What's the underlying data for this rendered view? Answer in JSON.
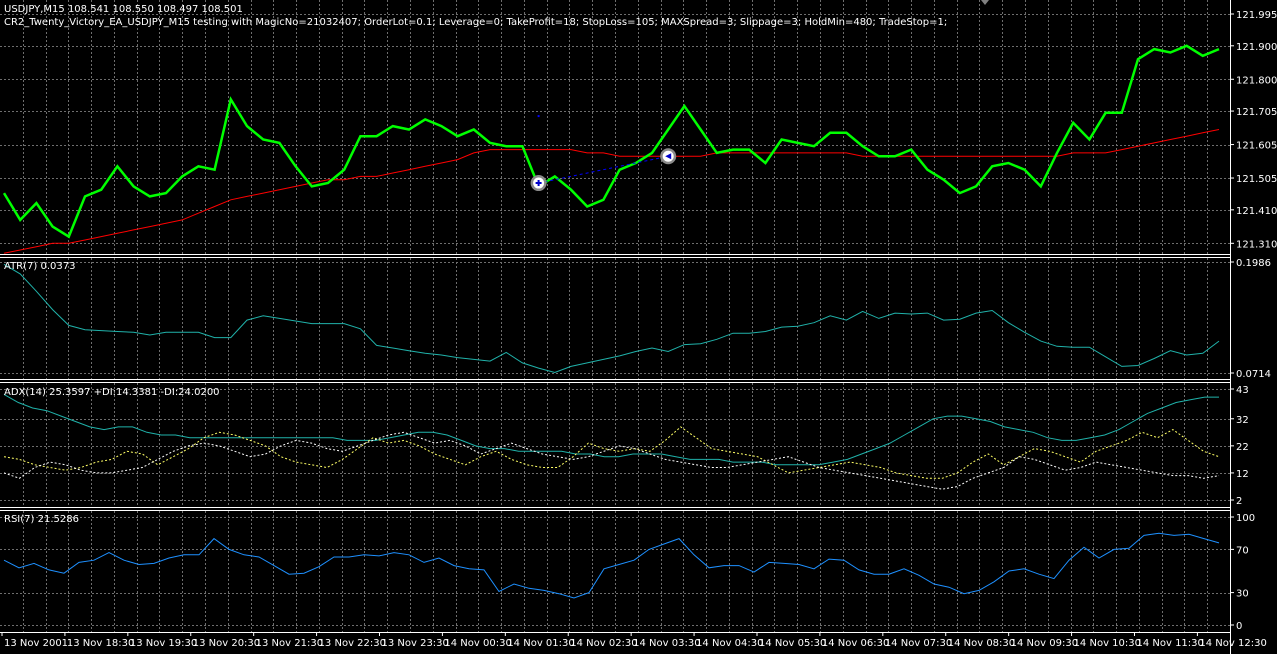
{
  "header": {
    "symbol_line": "USDJPY,M15  108.541 108.550 108.497 108.501",
    "ea_line": "CR2_Twenty_Victory_EA_USDJPY_M15 testing with MagicNo=21032407; OrderLot=0.1; Leverage=0; TakeProfit=18; StopLoss=105; MAXSpread=3; Slippage=3; HoldMin=480; TradeStop=1;"
  },
  "colors": {
    "background": "#000000",
    "grid": "#6e6e6e",
    "price_line": "#00ff00",
    "ma_line": "#ff0000",
    "atr_line": "#20b2aa",
    "adx_line": "#20b2aa",
    "plus_di_line": "#ffff66",
    "minus_di_line": "#ffffff",
    "rsi_line": "#1e90ff",
    "trade_line": "#0000ff"
  },
  "chart_data": [
    {
      "type": "line",
      "panel": "price",
      "ylim": [
        121.29,
        121.995
      ],
      "yticks": [
        "121.995",
        "121.900",
        "121.800",
        "121.705",
        "121.605",
        "121.505",
        "121.410",
        "121.310"
      ],
      "series": [
        {
          "key": "close",
          "values": [
            121.46,
            121.38,
            121.43,
            121.36,
            121.33,
            121.45,
            121.47,
            121.54,
            121.48,
            121.45,
            121.46,
            121.51,
            121.54,
            121.53,
            121.74,
            121.66,
            121.62,
            121.61,
            121.54,
            121.48,
            121.49,
            121.53,
            121.63,
            121.63,
            121.66,
            121.65,
            121.68,
            121.66,
            121.63,
            121.65,
            121.61,
            121.6,
            121.6,
            121.48,
            121.51,
            121.47,
            121.42,
            121.44,
            121.53,
            121.55,
            121.58,
            121.65,
            121.72,
            121.65,
            121.58,
            121.59,
            121.59,
            121.55,
            121.62,
            121.61,
            121.6,
            121.64,
            121.64,
            121.6,
            121.57,
            121.57,
            121.59,
            121.53,
            121.5,
            121.46,
            121.48,
            121.54,
            121.55,
            121.53,
            121.48,
            121.58,
            121.67,
            121.62,
            121.7,
            121.7,
            121.86,
            121.89,
            121.88,
            121.9,
            121.87,
            121.89
          ]
        },
        {
          "key": "ma",
          "values": [
            121.28,
            121.29,
            121.3,
            121.31,
            121.31,
            121.32,
            121.33,
            121.34,
            121.35,
            121.36,
            121.37,
            121.38,
            121.4,
            121.42,
            121.44,
            121.45,
            121.46,
            121.47,
            121.48,
            121.49,
            121.5,
            121.5,
            121.51,
            121.51,
            121.52,
            121.53,
            121.54,
            121.55,
            121.56,
            121.58,
            121.59,
            121.59,
            121.59,
            121.59,
            121.59,
            121.59,
            121.58,
            121.58,
            121.57,
            121.57,
            121.57,
            121.57,
            121.57,
            121.57,
            121.58,
            121.58,
            121.58,
            121.58,
            121.58,
            121.58,
            121.58,
            121.58,
            121.58,
            121.57,
            121.57,
            121.57,
            121.57,
            121.57,
            121.57,
            121.57,
            121.57,
            121.57,
            121.57,
            121.57,
            121.57,
            121.57,
            121.58,
            121.58,
            121.58,
            121.59,
            121.6,
            121.61,
            121.62,
            121.63,
            121.64,
            121.65
          ]
        }
      ],
      "trades": [
        {
          "open_bar": 33,
          "open_price": 121.49,
          "close_bar": 41,
          "close_price": 121.57
        }
      ],
      "marker": {
        "bar": 33,
        "price": 121.69
      }
    },
    {
      "type": "line",
      "panel": "atr",
      "title": "ATR(7) 0.0373",
      "ylim": [
        0.0714,
        0.1986
      ],
      "yticks": [
        "0.1986",
        "0.0714"
      ],
      "series": [
        {
          "key": "atr",
          "values": [
            0.196,
            0.185,
            0.165,
            0.144,
            0.126,
            0.121,
            0.12,
            0.119,
            0.118,
            0.115,
            0.118,
            0.118,
            0.118,
            0.112,
            0.112,
            0.132,
            0.137,
            0.134,
            0.131,
            0.128,
            0.128,
            0.128,
            0.122,
            0.103,
            0.1,
            0.097,
            0.094,
            0.092,
            0.089,
            0.087,
            0.085,
            0.095,
            0.083,
            0.077,
            0.072,
            0.079,
            0.083,
            0.087,
            0.091,
            0.096,
            0.1,
            0.096,
            0.104,
            0.105,
            0.11,
            0.117,
            0.117,
            0.119,
            0.124,
            0.125,
            0.129,
            0.137,
            0.132,
            0.142,
            0.134,
            0.14,
            0.139,
            0.14,
            0.132,
            0.133,
            0.14,
            0.143,
            0.129,
            0.118,
            0.108,
            0.102,
            0.101,
            0.101,
            0.09,
            0.079,
            0.08,
            0.088,
            0.097,
            0.092,
            0.094,
            0.108
          ]
        }
      ]
    },
    {
      "type": "line",
      "panel": "adx",
      "title": "ADX(14) 25.3597 +DI:14.3381 -DI:24.0200",
      "ylim": [
        2,
        43
      ],
      "yticks": [
        "43",
        "32",
        "22",
        "12",
        "2"
      ],
      "series": [
        {
          "key": "adx",
          "values": [
            41,
            38,
            36,
            35,
            33,
            31,
            29,
            28,
            29,
            29,
            27,
            26,
            26,
            25,
            25,
            25,
            25,
            25,
            25,
            25,
            25,
            25,
            25,
            25,
            24,
            24,
            24,
            25,
            26,
            27,
            27,
            26,
            24,
            22,
            21,
            21,
            20,
            20,
            20,
            20,
            19,
            19,
            18,
            18,
            19,
            19,
            19,
            18,
            17,
            17,
            17,
            16,
            16,
            16,
            15,
            15,
            15,
            15,
            16,
            17,
            19,
            21,
            23,
            26,
            29,
            32,
            33,
            33,
            32,
            31,
            29,
            28,
            27,
            25,
            24,
            24,
            25,
            26,
            28,
            31,
            34,
            36,
            38,
            39,
            40,
            40
          ]
        },
        {
          "key": "plus_di",
          "values": [
            18,
            17,
            15,
            14,
            13,
            14,
            16,
            17,
            20,
            19,
            15,
            18,
            21,
            25,
            27,
            26,
            24,
            22,
            18,
            16,
            15,
            14,
            17,
            21,
            25,
            23,
            24,
            22,
            19,
            17,
            15,
            18,
            20,
            17,
            15,
            14,
            14,
            18,
            23,
            21,
            20,
            21,
            20,
            24,
            29,
            25,
            21,
            20,
            19,
            18,
            15,
            12,
            13,
            14,
            15,
            16,
            15,
            14,
            12,
            11,
            10,
            10,
            12,
            16,
            19,
            15,
            18,
            21,
            20,
            18,
            16,
            20,
            22,
            24,
            27,
            25,
            28,
            24,
            20,
            18
          ]
        },
        {
          "key": "minus_di",
          "values": [
            12,
            10,
            14,
            16,
            15,
            13,
            12,
            12,
            13,
            14,
            17,
            20,
            22,
            23,
            22,
            20,
            18,
            19,
            22,
            24,
            23,
            21,
            20,
            22,
            24,
            26,
            27,
            25,
            23,
            24,
            22,
            19,
            21,
            23,
            21,
            19,
            18,
            17,
            18,
            20,
            22,
            21,
            19,
            17,
            16,
            15,
            14,
            14,
            15,
            16,
            17,
            18,
            16,
            14,
            13,
            12,
            11,
            10,
            9,
            8,
            7,
            6,
            7,
            10,
            12,
            14,
            18,
            17,
            15,
            13,
            14,
            16,
            15,
            14,
            13,
            12,
            11,
            11,
            10,
            11
          ]
        }
      ]
    },
    {
      "type": "line",
      "panel": "rsi",
      "title": "RSI(7) 21.5286",
      "ylim": [
        0,
        100
      ],
      "yticks": [
        "100",
        "70",
        "30",
        "0"
      ],
      "series": [
        {
          "key": "rsi",
          "values": [
            60,
            53,
            57,
            51,
            48,
            58,
            60,
            67,
            60,
            56,
            57,
            62,
            65,
            65,
            80,
            70,
            65,
            63,
            55,
            47,
            48,
            54,
            63,
            63,
            65,
            64,
            67,
            65,
            58,
            62,
            55,
            52,
            51,
            31,
            38,
            34,
            32,
            29,
            25,
            30,
            52,
            56,
            60,
            70,
            75,
            80,
            65,
            53,
            55,
            55,
            49,
            58,
            57,
            56,
            52,
            61,
            60,
            51,
            47,
            47,
            52,
            46,
            38,
            35,
            29,
            32,
            40,
            50,
            52,
            47,
            43,
            60,
            72,
            62,
            70,
            71,
            83,
            85,
            83,
            84,
            80,
            76
          ]
        }
      ]
    }
  ],
  "x_axis": {
    "ticks": [
      "13 Nov 2001",
      "13 Nov 18:30",
      "13 Nov 19:30",
      "13 Nov 20:30",
      "13 Nov 21:30",
      "13 Nov 22:30",
      "13 Nov 23:30",
      "14 Nov 00:30",
      "14 Nov 01:30",
      "14 Nov 02:30",
      "14 Nov 03:30",
      "14 Nov 04:30",
      "14 Nov 05:30",
      "14 Nov 06:30",
      "14 Nov 07:30",
      "14 Nov 08:30",
      "14 Nov 09:30",
      "14 Nov 10:30",
      "14 Nov 11:30",
      "14 Nov 12:30"
    ]
  }
}
